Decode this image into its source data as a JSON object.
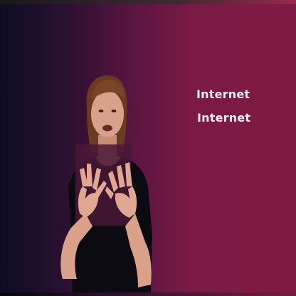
{
  "caption": {
    "line_1": "Internet",
    "line_2": "Internet"
  },
  "colors": {
    "background_left": "#0c0d24",
    "background_right": "#811a44",
    "caption_text": "#f4eef2",
    "shirt": "#0d0b12",
    "skin": "#d9a08a",
    "hair": "#6b3a22"
  },
  "figure": {
    "description_icon": "sign-language-interpreter"
  }
}
